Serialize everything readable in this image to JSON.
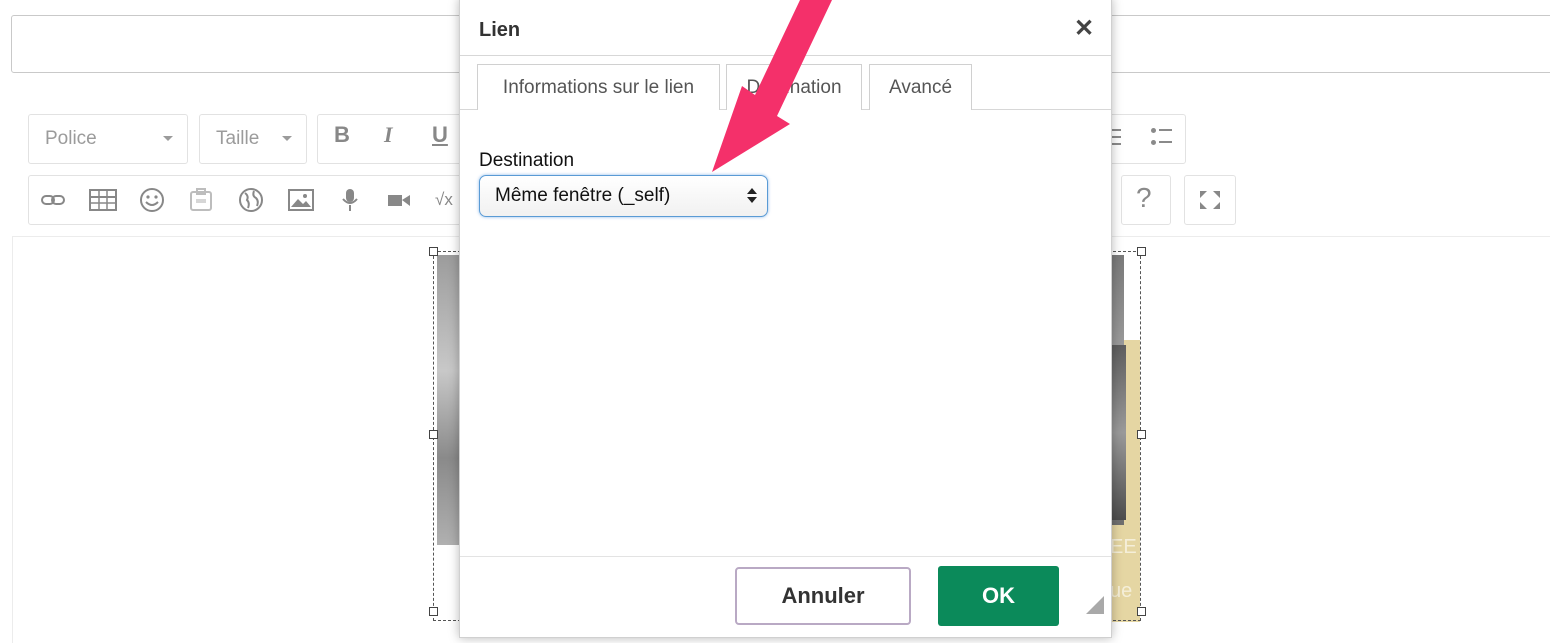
{
  "dialog": {
    "title": "Lien",
    "close_glyph": "✕",
    "tabs": [
      {
        "label": "Informations sur le lien",
        "active": false
      },
      {
        "label": "Destination",
        "active": true
      },
      {
        "label": "Avancé",
        "active": false
      }
    ],
    "field_label": "Destination",
    "select_value": "Même fenêtre (_self)",
    "cancel_label": "Annuler",
    "ok_label": "OK"
  },
  "toolbar": {
    "font_combo": "Police",
    "size_combo": "Taille",
    "bold": "B",
    "italic": "I",
    "underline": "U",
    "help": "?",
    "formula": "√x"
  },
  "image": {
    "visible_letters_1": "EE",
    "visible_letters_2": "ue"
  },
  "colors": {
    "ok_button": "#0b8a5a",
    "annotation_arrow": "#f4306a",
    "select_focus": "#5a9bd5"
  }
}
